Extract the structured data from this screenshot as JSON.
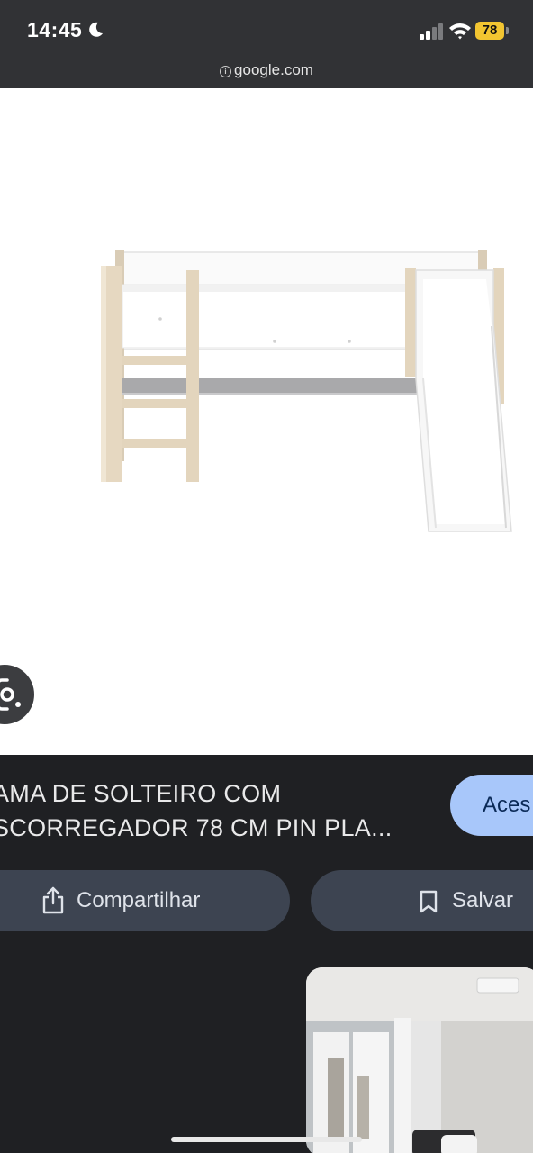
{
  "status_bar": {
    "time": "14:45",
    "battery": "78",
    "battery_color": "#f2c531"
  },
  "browser": {
    "url": "google.com",
    "url_icon": "info-icon"
  },
  "image_viewer": {
    "image_subject": "bed-with-slide-image",
    "lens_icon": "lens-icon"
  },
  "result": {
    "title_line1": "AMA DE SOLTEIRO COM",
    "title_line2": "SCORREGADOR 78 CM PIN PLA...",
    "visit_label": "Aces",
    "visit_color": "#a8c7fa"
  },
  "actions": {
    "share_label": "Compartilhar",
    "share_icon": "share-icon",
    "save_label": "Salvar",
    "save_icon": "bookmark-icon",
    "pill_color": "#3d4451"
  },
  "related": {
    "thumbnail": "bedroom-image"
  }
}
